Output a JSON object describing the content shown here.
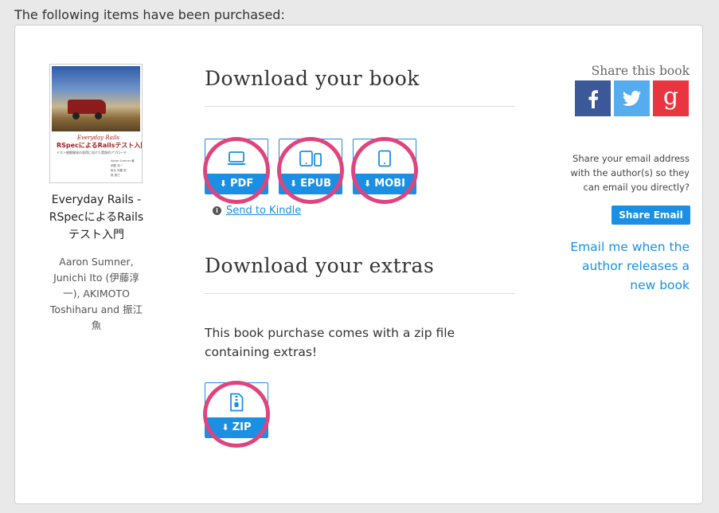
{
  "intro_text": "The following items have been purchased:",
  "book": {
    "cover": {
      "series": "Everyday Rails",
      "title": "RSpecによるRailsテスト入門",
      "subtitle": "テスト駆動開発の習得に向けた実践的アプローチ",
      "authors_small": "Aaron Sumner 著\n伊藤 淳一\n秋元 利春 訳\n魚 振江"
    },
    "title_lines": [
      "Everyday Rails -",
      "RSpecによるRails",
      "テスト入門"
    ],
    "authors_lines": [
      "Aaron Sumner,",
      "Junichi Ito (伊藤淳",
      "一), AKIMOTO",
      "Toshiharu and 振江",
      "魚"
    ]
  },
  "download_book": {
    "heading": "Download your book",
    "formats": [
      {
        "label": "PDF",
        "icon": "laptop-icon"
      },
      {
        "label": "EPUB",
        "icon": "devices-icon"
      },
      {
        "label": "MOBI",
        "icon": "tablet-icon"
      }
    ],
    "kindle_label": "Send to Kindle"
  },
  "download_extras": {
    "heading": "Download your extras",
    "description": "This book purchase comes with a zip file containing extras!",
    "zip_label": "ZIP"
  },
  "share": {
    "label": "Share this book",
    "email_text": "Share your email address with the author(s) so they can email you directly?",
    "email_button": "Share Email",
    "notify_link": "Email me when the author releases a new book"
  },
  "colors": {
    "accent": "#1a8fe3",
    "highlight_ring": "#e0447e",
    "facebook": "#3b5998",
    "twitter": "#55acee",
    "google": "#e8353f"
  }
}
